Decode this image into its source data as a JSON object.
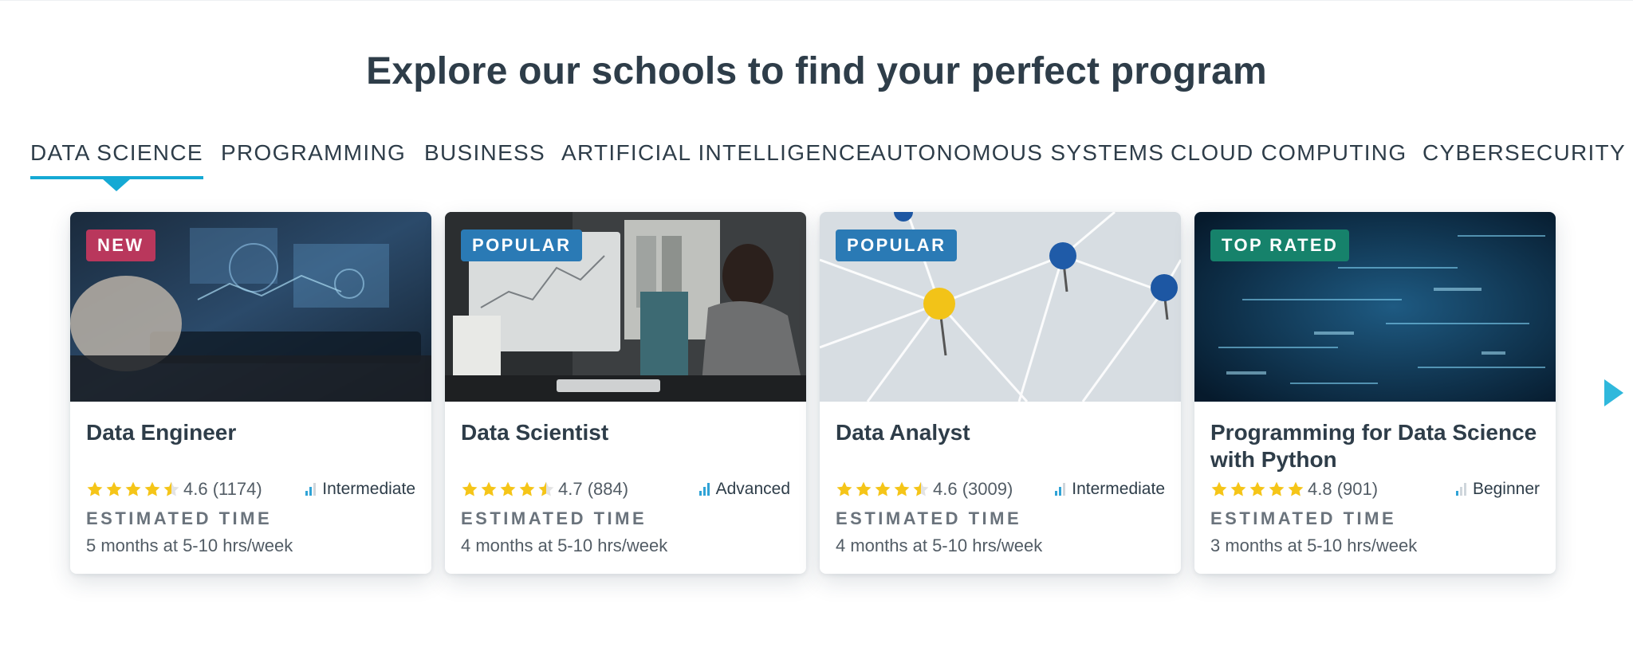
{
  "heading": "Explore our schools to find your perfect program",
  "tabs": [
    {
      "label": "DATA SCIENCE",
      "active": true
    },
    {
      "label": "PROGRAMMING"
    },
    {
      "label": "BUSINESS"
    },
    {
      "label": "ARTIFICIAL INTELLIGENCE"
    },
    {
      "label": "AUTONOMOUS SYSTEMS"
    },
    {
      "label": "CLOUD COMPUTING"
    },
    {
      "label": "CYBERSECURITY"
    }
  ],
  "colors": {
    "accent": "#15a9d4",
    "badge_new": "#b9375c",
    "badge_popular": "#2a7ab5",
    "badge_top_rated": "#16826b",
    "star": "#f5c518",
    "level_bar": "#2fa3d6"
  },
  "cards": [
    {
      "badge": "NEW",
      "title": "Data Engineer",
      "rating": 4.6,
      "rating_text": "4.6 (1174)",
      "level": "Intermediate",
      "est_label": "ESTIMATED TIME",
      "est_value": "5 months at 5-10 hrs/week",
      "image": "tablet-data-visualization"
    },
    {
      "badge": "POPULAR",
      "title": "Data Scientist",
      "rating": 4.7,
      "rating_text": "4.7 (884)",
      "level": "Advanced",
      "est_label": "ESTIMATED TIME",
      "est_value": "4 months at 5-10 hrs/week",
      "image": "woman-at-computer"
    },
    {
      "badge": "POPULAR",
      "title": "Data Analyst",
      "rating": 4.6,
      "rating_text": "4.6 (3009)",
      "level": "Intermediate",
      "est_label": "ESTIMATED TIME",
      "est_value": "4 months at 5-10 hrs/week",
      "image": "pins-connected-by-strings"
    },
    {
      "badge": "TOP RATED",
      "title": "Programming for Data Science with Python",
      "rating": 4.8,
      "rating_text": "4.8 (901)",
      "level": "Beginner",
      "est_label": "ESTIMATED TIME",
      "est_value": "3 months at 5-10 hrs/week",
      "image": "digital-code-background"
    }
  ],
  "next_icon": "chevron-right-icon"
}
